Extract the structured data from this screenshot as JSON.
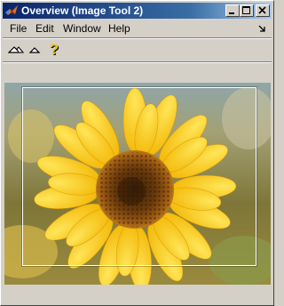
{
  "window": {
    "title": "Overview (Image Tool 2)"
  },
  "title_buttons": {
    "minimize_icon": "minimize-icon",
    "maximize_icon": "maximize-icon",
    "close_icon": "close-icon"
  },
  "menu": {
    "items": [
      "File",
      "Edit",
      "Window",
      "Help"
    ]
  },
  "toolbar": {
    "icons": [
      "zoom-out-icon",
      "zoom-in-icon",
      "help-icon"
    ]
  },
  "image": {
    "subject": "sunflower",
    "roi_visible": true
  },
  "colors": {
    "title_active": "#0a246a",
    "chrome": "#d4d0c8",
    "help_icon": "#e8c800"
  }
}
